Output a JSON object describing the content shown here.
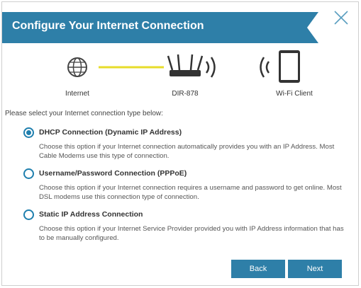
{
  "dialog": {
    "title": "Configure Your Internet Connection",
    "accent_color": "#2e7fa8"
  },
  "diagram": {
    "internet_label": "Internet",
    "router_label": "DIR-878",
    "client_label": "Wi-Fi Client",
    "link_color": "#e7dc2a"
  },
  "prompt": "Please select your Internet connection type below:",
  "options": [
    {
      "title": "DHCP Connection (Dynamic IP Address)",
      "description": "Choose this option if your Internet connection automatically provides you with an IP Address. Most Cable Modems use this type of connection.",
      "selected": true
    },
    {
      "title": "Username/Password Connection (PPPoE)",
      "description": "Choose this option if your Internet connection requires a username and password to get online. Most DSL modems use this connection type of connection.",
      "selected": false
    },
    {
      "title": "Static IP Address Connection",
      "description": "Choose this option if your Internet Service Provider provided you with IP Address information that has to be manually configured.",
      "selected": false
    }
  ],
  "buttons": {
    "back": "Back",
    "next": "Next"
  }
}
